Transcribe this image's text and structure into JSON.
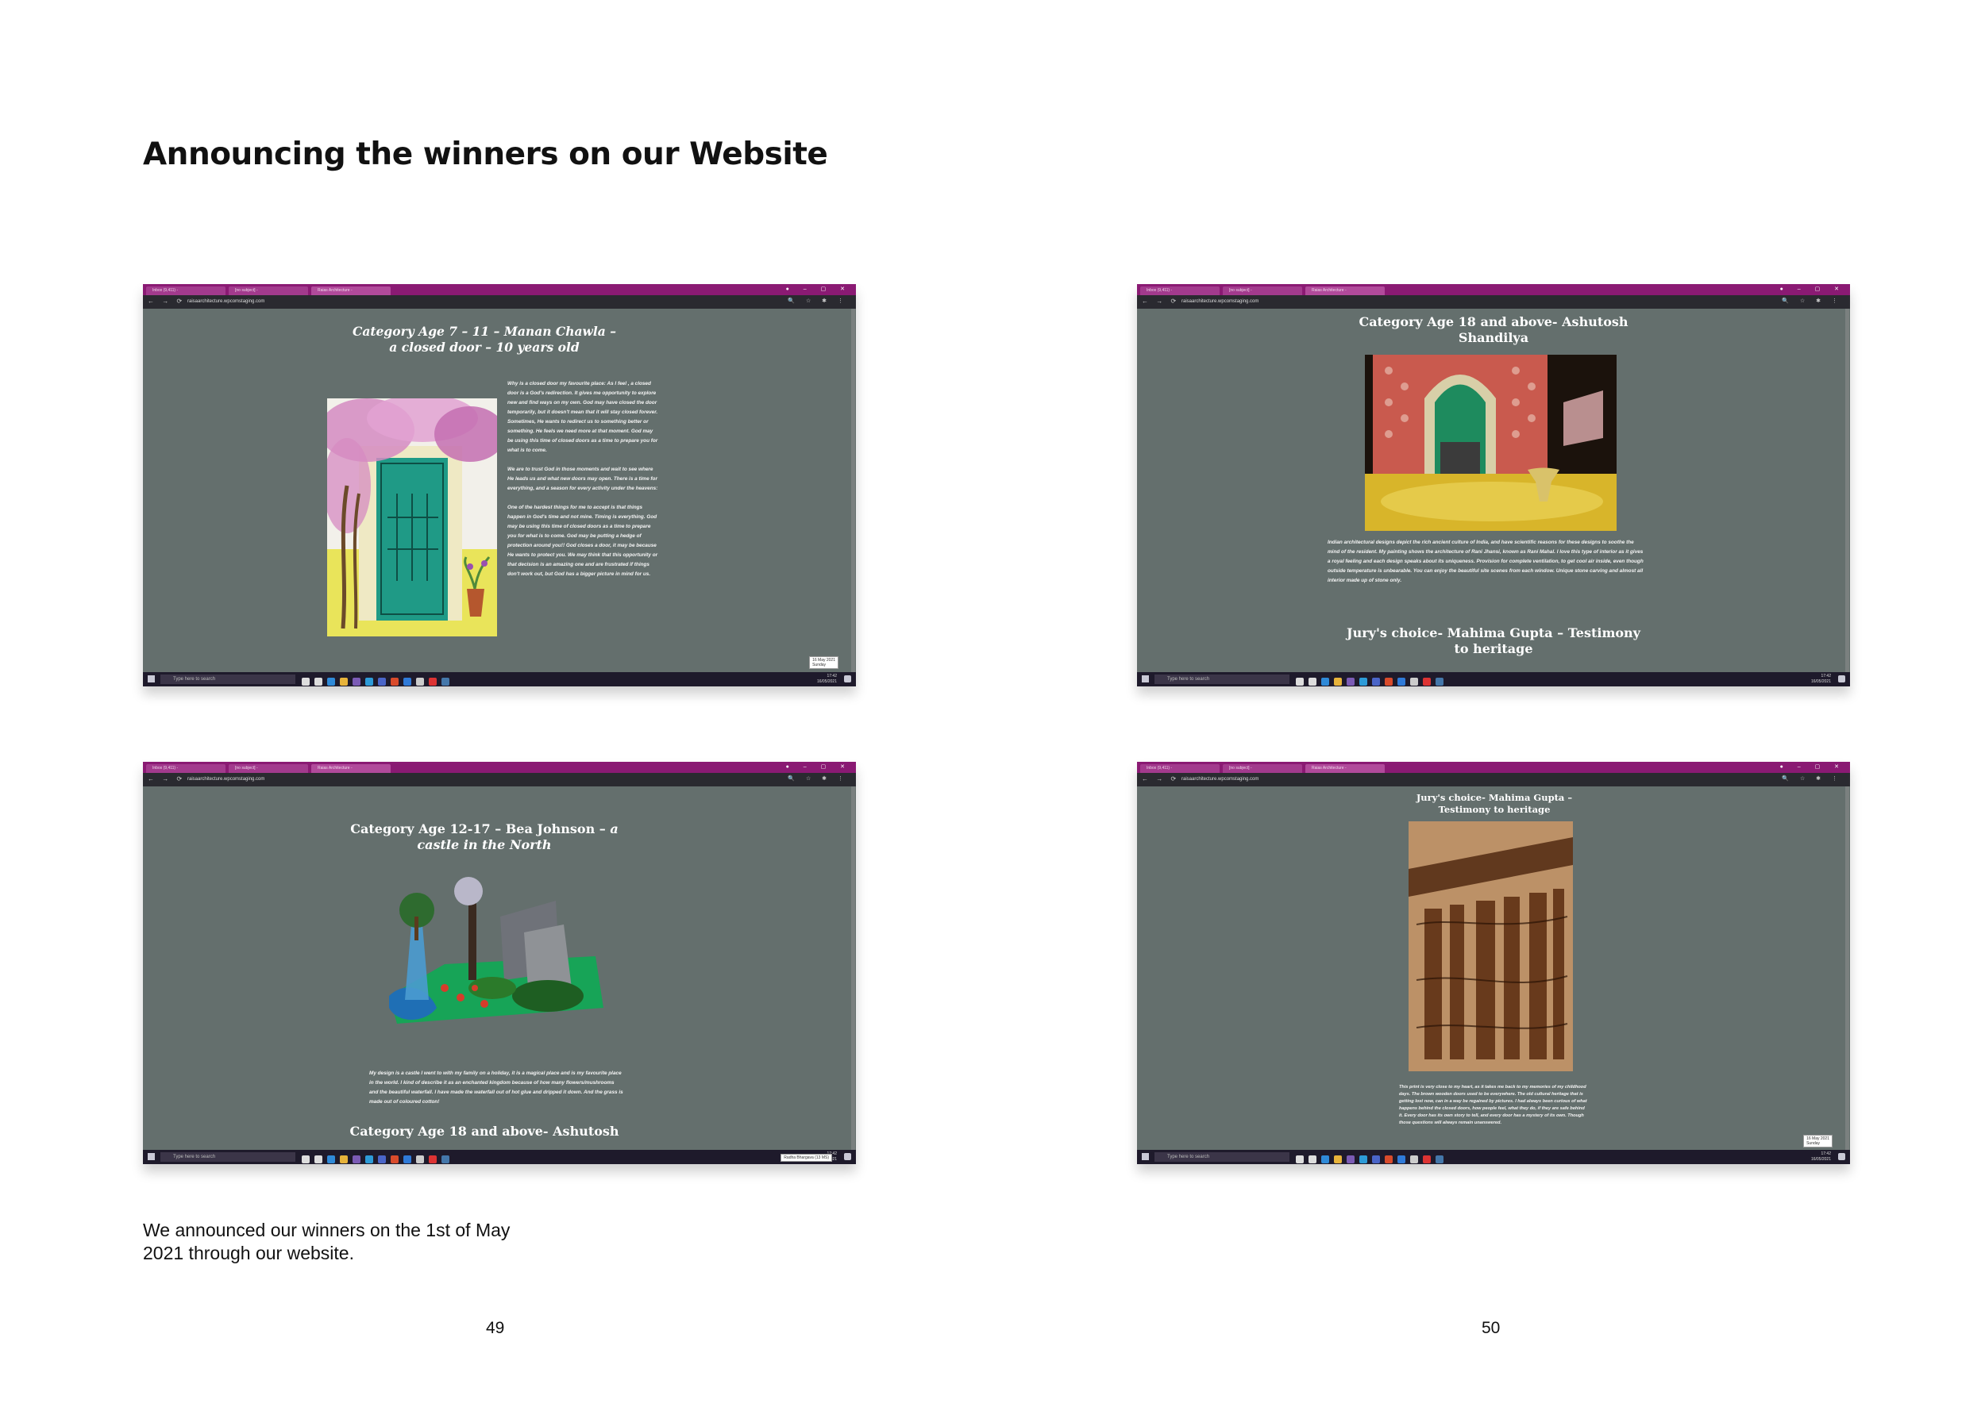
{
  "page_title": "Announcing the winners on our Website",
  "caption": "We announced our winners on the 1st of May 2021 through our website.",
  "page_numbers": {
    "left": "49",
    "right": "50"
  },
  "browser": {
    "tabs": [
      "Inbox (9,411) - ",
      "[no subject] - ",
      "Raias Architecture - "
    ],
    "url": "raisaarchitecture.wpcomstaging.com",
    "taskbar_search": "Type here to search",
    "clock_time": "17:42",
    "clock_date": "16/05/2021",
    "clock_lang": "ENG"
  },
  "shots": {
    "s1": {
      "title_a": "Category Age 7 – 11  – Manan Chawla –",
      "title_b": "a closed door – 10 years old",
      "text": "Why is a closed door my favourite place: As I feel , a closed door is a God's redirection. It gives me opportunity to explore new and find ways on my own. God may have closed the door temporarily, but it doesn't mean that it will stay closed forever. Sometimes, He wants to redirect us to something better or something. He feels we need more at that moment. God may be using this time of closed doors as a time to prepare you for what is to come.\n\nWe are to trust God in those moments and wait to see where He leads us and what new doors may open. There is a time for everything, and a season for every activity under the heavens:\n\nOne of the hardest things for me to accept is that things happen in God's time and not mine. Timing is everything. God may be using this time of closed doors as a time to prepare you for what is to come. God may be putting a hedge of protection around you!! God closes a door, it may be because He wants to protect you. We may think that this opportunity or that decision is an amazing one and are frustrated if things don't work out, but God has a bigger picture in mind for us.",
      "tooltip": "16 May 2021\nSunday"
    },
    "s2": {
      "title": "Category Age 18 and above- Ashutosh Shandilya",
      "text": "Indian architectural designs depict the rich ancient culture of India, and have scientific reasons for these designs to soothe the mind of the resident. My painting shows the architecture of Rani Jhansi, known as Rani Mahal. I love this type of interior as it gives a royal feeling and each design speaks about its uniqueness. Provision for complete ventilation, to get cool air inside, even though outside temperature is unbearable. You can enjoy the beautiful site scenes from each window. Unique stone carving and almost all interior made up of stone only.",
      "subtitle": "Jury's choice- Mahima Gupta – Testimony to heritage"
    },
    "s3": {
      "title_a": "Category Age 12-17 – Bea Johnson – ",
      "title_a_i": "a",
      "title_b": "castle in the North",
      "text": "My design is a castle I went to with my family on a holiday, it is a magical place and is my favourite place in the world. I kind of describe it as an enchanted kingdom because of how many flowers/mushrooms and the beautiful waterfall. I have made the waterfall out of hot glue and dripped it down. And the grass is made out of coloured cotton!",
      "bottom_title": "Category Age 18 and above- Ashutosh",
      "tooltip": "Radha Bhargava (13 MS)"
    },
    "s4": {
      "title_a": "Jury's choice- Mahima Gupta –",
      "title_b": "Testimony to heritage",
      "text": "This print is very close to my heart, as it takes me back to my memories of my childhood days. The brown wooden doors used to be everywhere. The old cultural heritage that is getting lost now, can in a way be regained by pictures. I had always been curious of what happens behind the closed doors, how people feel, what they do, if they are safe behind it. Every door has its own story to tell, and every door has a mystery of its own. Though those questions will always remain unanswered.",
      "tooltip": "16 May 2021\nSunday"
    }
  }
}
